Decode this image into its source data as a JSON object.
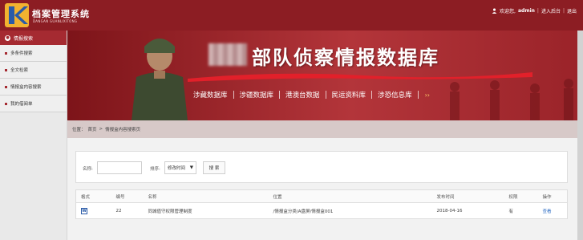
{
  "header": {
    "logo_letter": "K",
    "app_title": "档案管理系统",
    "app_subtitle": "DANGAN GUANLIXITONG",
    "greeting": "欢迎您,",
    "username": "admin",
    "back_link": "进入后台",
    "logout": "退出"
  },
  "sidebar": {
    "section_title": "情报搜索",
    "section_icon": "search-circle-icon",
    "items": [
      {
        "label": "多条件搜索"
      },
      {
        "label": "全文检索"
      },
      {
        "label": "情报盒内容搜索"
      },
      {
        "label": "我的借阅单"
      }
    ]
  },
  "banner": {
    "title": "部队侦察情报数据库",
    "tabs": [
      "涉藏数据库",
      "涉疆数据库",
      "港澳台数据",
      "民运资料库",
      "涉恐信息库"
    ],
    "more_glyph": "››"
  },
  "breadcrumb": {
    "label": "位置：",
    "home": "首页",
    "separator": ">",
    "current": "情报盒内容搜索页"
  },
  "search": {
    "name_label": "名称:",
    "name_value": "",
    "sort_label": "排序:",
    "sort_value": "修改时间",
    "button": "搜 索"
  },
  "table": {
    "columns": [
      "格式",
      "编号",
      "名称",
      "位置",
      "发布时间",
      "权限",
      "操作"
    ],
    "rows": [
      {
        "format": "W",
        "number": "22",
        "name": "同城值守权限管理制度",
        "location": "/情报盒分类/A盘屏/情报盒001",
        "date": "2018-04-16",
        "permission": "有",
        "action": "查看"
      }
    ]
  },
  "colors": {
    "header_bg": "#8c1d23",
    "nav_head_bg": "#a52a31",
    "banner_gold": "#ffcf6b",
    "link_blue": "#2b6cc4"
  }
}
